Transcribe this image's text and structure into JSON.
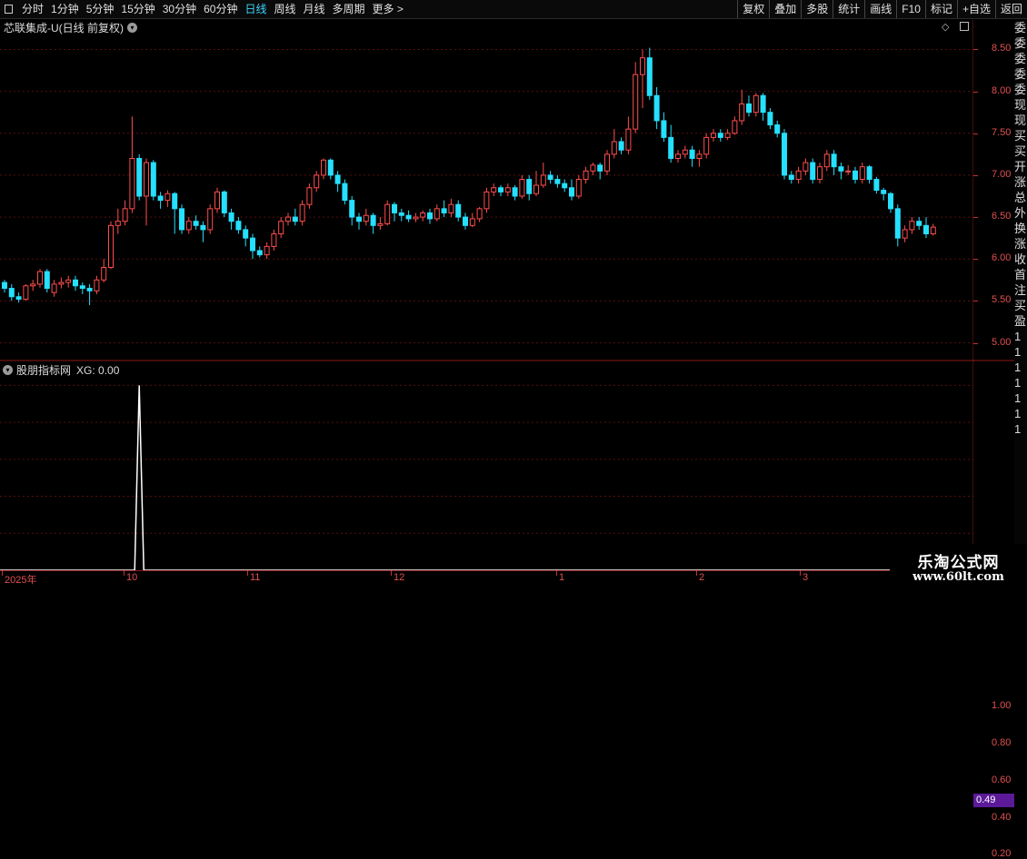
{
  "toolbar": {
    "periods": [
      "分时",
      "1分钟",
      "5分钟",
      "15分钟",
      "30分钟",
      "60分钟",
      "日线",
      "周线",
      "月线",
      "多周期",
      "更多 >"
    ],
    "active_period": "日线",
    "right_buttons": [
      "复权",
      "叠加",
      "多股",
      "统计",
      "画线",
      "F10",
      "标记",
      "+自选",
      "返回"
    ]
  },
  "main_panel": {
    "title": "芯联集成-U(日线 前复权)",
    "price_labels": [
      "8.50",
      "8.00",
      "7.50",
      "7.00",
      "6.50",
      "6.00",
      "5.50",
      "5.00"
    ]
  },
  "indicator_panel": {
    "title": "股朋指标网",
    "value_text": "XG: 0.00",
    "axis_labels": [
      "1.00",
      "0.80",
      "0.60",
      "0.40",
      "0.20"
    ],
    "current_value": "0.49"
  },
  "date_axis": {
    "labels": [
      "2025年",
      "10",
      "11",
      "12",
      "1",
      "2",
      "3"
    ]
  },
  "sidebar_text": [
    "委",
    "委",
    "委",
    "委",
    "委",
    "现",
    "现",
    "买",
    "买",
    "开",
    "涨",
    "总",
    "外",
    "换",
    "涨",
    "收",
    "首",
    "注",
    "买",
    "盈",
    "1",
    "1",
    "1",
    "1",
    "1",
    "1",
    "1"
  ],
  "watermark": {
    "title": "乐淘公式网",
    "url": "www.60lt.com"
  },
  "colors": {
    "up": "#ff4d4d",
    "down": "#25e0ff",
    "grid": "#5a0d0d",
    "axis_line": "#8b1a1a",
    "highlight": "#5c1a99"
  },
  "chart_data": [
    {
      "type": "candlestick",
      "series_name": "芯联集成-U",
      "ylim": [
        4.8,
        8.7
      ],
      "yticks": [
        5.0,
        5.5,
        6.0,
        6.5,
        7.0,
        7.5,
        8.0,
        8.5
      ],
      "candles": [
        [
          5.72,
          5.65,
          5.75,
          5.6
        ],
        [
          5.65,
          5.55,
          5.7,
          5.5
        ],
        [
          5.55,
          5.52,
          5.6,
          5.48
        ],
        [
          5.52,
          5.68,
          5.7,
          5.5
        ],
        [
          5.68,
          5.7,
          5.75,
          5.62
        ],
        [
          5.7,
          5.85,
          5.88,
          5.66
        ],
        [
          5.85,
          5.65,
          5.88,
          5.6
        ],
        [
          5.6,
          5.7,
          5.75,
          5.55
        ],
        [
          5.7,
          5.72,
          5.78,
          5.65
        ],
        [
          5.72,
          5.75,
          5.8,
          5.66
        ],
        [
          5.75,
          5.68,
          5.8,
          5.62
        ],
        [
          5.68,
          5.65,
          5.72,
          5.58
        ],
        [
          5.65,
          5.62,
          5.7,
          5.45
        ],
        [
          5.62,
          5.75,
          5.8,
          5.58
        ],
        [
          5.75,
          5.9,
          6.0,
          5.72
        ],
        [
          5.9,
          6.4,
          6.45,
          5.88
        ],
        [
          6.4,
          6.45,
          6.6,
          6.3
        ],
        [
          6.45,
          6.6,
          6.7,
          6.4
        ],
        [
          6.6,
          7.2,
          7.7,
          6.55
        ],
        [
          7.2,
          6.75,
          7.25,
          6.7
        ],
        [
          6.75,
          7.15,
          7.2,
          6.4
        ],
        [
          7.15,
          6.75,
          7.18,
          6.7
        ],
        [
          6.75,
          6.7,
          6.8,
          6.6
        ],
        [
          6.7,
          6.78,
          6.82,
          6.62
        ],
        [
          6.78,
          6.6,
          6.8,
          6.3
        ],
        [
          6.6,
          6.35,
          6.65,
          6.3
        ],
        [
          6.35,
          6.45,
          6.5,
          6.3
        ],
        [
          6.45,
          6.4,
          6.52,
          6.35
        ],
        [
          6.4,
          6.35,
          6.45,
          6.2
        ],
        [
          6.35,
          6.6,
          6.65,
          6.3
        ],
        [
          6.6,
          6.8,
          6.85,
          6.55
        ],
        [
          6.8,
          6.55,
          6.82,
          6.5
        ],
        [
          6.55,
          6.45,
          6.6,
          6.35
        ],
        [
          6.45,
          6.35,
          6.5,
          6.3
        ],
        [
          6.35,
          6.25,
          6.4,
          6.15
        ],
        [
          6.25,
          6.1,
          6.3,
          6.0
        ],
        [
          6.1,
          6.05,
          6.15,
          6.02
        ],
        [
          6.05,
          6.15,
          6.2,
          6.0
        ],
        [
          6.15,
          6.3,
          6.35,
          6.1
        ],
        [
          6.3,
          6.45,
          6.5,
          6.25
        ],
        [
          6.45,
          6.5,
          6.55,
          6.4
        ],
        [
          6.5,
          6.45,
          6.6,
          6.4
        ],
        [
          6.45,
          6.65,
          6.7,
          6.4
        ],
        [
          6.65,
          6.85,
          6.9,
          6.6
        ],
        [
          6.85,
          7.0,
          7.05,
          6.8
        ],
        [
          7.0,
          7.18,
          7.2,
          6.95
        ],
        [
          7.18,
          7.0,
          7.2,
          6.95
        ],
        [
          7.0,
          6.9,
          7.05,
          6.8
        ],
        [
          6.9,
          6.7,
          6.95,
          6.65
        ],
        [
          6.7,
          6.5,
          6.75,
          6.4
        ],
        [
          6.5,
          6.45,
          6.55,
          6.35
        ],
        [
          6.45,
          6.52,
          6.6,
          6.4
        ],
        [
          6.52,
          6.4,
          6.55,
          6.3
        ],
        [
          6.4,
          6.42,
          6.5,
          6.35
        ],
        [
          6.42,
          6.65,
          6.7,
          6.4
        ],
        [
          6.65,
          6.55,
          6.68,
          6.45
        ],
        [
          6.55,
          6.52,
          6.6,
          6.45
        ],
        [
          6.52,
          6.48,
          6.58,
          6.44
        ],
        [
          6.48,
          6.5,
          6.55,
          6.44
        ],
        [
          6.5,
          6.55,
          6.58,
          6.45
        ],
        [
          6.55,
          6.48,
          6.6,
          6.42
        ],
        [
          6.48,
          6.6,
          6.65,
          6.45
        ],
        [
          6.6,
          6.55,
          6.7,
          6.5
        ],
        [
          6.55,
          6.65,
          6.72,
          6.5
        ],
        [
          6.65,
          6.5,
          6.7,
          6.45
        ],
        [
          6.5,
          6.4,
          6.55,
          6.35
        ],
        [
          6.4,
          6.48,
          6.55,
          6.38
        ],
        [
          6.48,
          6.6,
          6.62,
          6.44
        ],
        [
          6.6,
          6.8,
          6.85,
          6.55
        ],
        [
          6.8,
          6.85,
          6.9,
          6.75
        ],
        [
          6.85,
          6.8,
          6.88,
          6.75
        ],
        [
          6.8,
          6.85,
          6.9,
          6.75
        ],
        [
          6.85,
          6.75,
          6.88,
          6.7
        ],
        [
          6.75,
          6.95,
          7.0,
          6.72
        ],
        [
          6.95,
          6.78,
          7.0,
          6.7
        ],
        [
          6.78,
          6.88,
          7.05,
          6.75
        ],
        [
          6.88,
          7.0,
          7.15,
          6.85
        ],
        [
          7.0,
          6.95,
          7.05,
          6.9
        ],
        [
          6.95,
          6.9,
          7.0,
          6.85
        ],
        [
          6.9,
          6.85,
          6.95,
          6.8
        ],
        [
          6.85,
          6.75,
          6.95,
          6.7
        ],
        [
          6.75,
          6.95,
          7.0,
          6.72
        ],
        [
          6.95,
          7.05,
          7.1,
          6.9
        ],
        [
          7.05,
          7.12,
          7.15,
          7.0
        ],
        [
          7.12,
          7.05,
          7.15,
          6.95
        ],
        [
          7.05,
          7.25,
          7.3,
          7.0
        ],
        [
          7.25,
          7.4,
          7.55,
          7.2
        ],
        [
          7.4,
          7.3,
          7.45,
          7.25
        ],
        [
          7.3,
          7.55,
          7.7,
          7.25
        ],
        [
          7.55,
          8.2,
          8.35,
          7.5
        ],
        [
          8.2,
          8.4,
          8.5,
          7.8
        ],
        [
          8.4,
          7.95,
          8.52,
          7.9
        ],
        [
          7.95,
          7.65,
          8.05,
          7.55
        ],
        [
          7.65,
          7.45,
          7.75,
          7.4
        ],
        [
          7.45,
          7.2,
          7.6,
          7.15
        ],
        [
          7.2,
          7.25,
          7.3,
          7.15
        ],
        [
          7.25,
          7.3,
          7.35,
          7.2
        ],
        [
          7.3,
          7.2,
          7.35,
          7.1
        ],
        [
          7.2,
          7.25,
          7.3,
          7.1
        ],
        [
          7.25,
          7.45,
          7.5,
          7.2
        ],
        [
          7.45,
          7.5,
          7.55,
          7.4
        ],
        [
          7.5,
          7.45,
          7.55,
          7.4
        ],
        [
          7.45,
          7.5,
          7.55,
          7.42
        ],
        [
          7.5,
          7.65,
          7.7,
          7.48
        ],
        [
          7.65,
          7.85,
          8.02,
          7.6
        ],
        [
          7.85,
          7.75,
          7.95,
          7.7
        ],
        [
          7.75,
          7.95,
          7.98,
          7.7
        ],
        [
          7.95,
          7.75,
          7.98,
          7.65
        ],
        [
          7.75,
          7.6,
          7.8,
          7.55
        ],
        [
          7.6,
          7.5,
          7.65,
          7.45
        ],
        [
          7.5,
          7.0,
          7.55,
          6.95
        ],
        [
          7.0,
          6.95,
          7.05,
          6.9
        ],
        [
          6.95,
          7.05,
          7.1,
          6.9
        ],
        [
          7.05,
          7.15,
          7.2,
          7.0
        ],
        [
          7.15,
          6.95,
          7.2,
          6.9
        ],
        [
          6.95,
          7.1,
          7.15,
          6.9
        ],
        [
          7.1,
          7.25,
          7.3,
          7.05
        ],
        [
          7.25,
          7.1,
          7.3,
          7.0
        ],
        [
          7.1,
          7.05,
          7.15,
          6.95
        ],
        [
          7.05,
          7.05,
          7.12,
          7.0
        ],
        [
          7.05,
          6.95,
          7.1,
          6.9
        ],
        [
          6.95,
          7.1,
          7.15,
          6.9
        ],
        [
          7.1,
          6.95,
          7.12,
          6.9
        ],
        [
          6.95,
          6.82,
          6.98,
          6.78
        ],
        [
          6.82,
          6.78,
          6.85,
          6.7
        ],
        [
          6.78,
          6.6,
          6.8,
          6.55
        ],
        [
          6.6,
          6.25,
          6.65,
          6.15
        ],
        [
          6.25,
          6.35,
          6.4,
          6.2
        ],
        [
          6.35,
          6.45,
          6.5,
          6.3
        ],
        [
          6.45,
          6.4,
          6.5,
          6.35
        ],
        [
          6.4,
          6.3,
          6.5,
          6.25
        ],
        [
          6.3,
          6.38,
          6.42,
          6.28
        ]
      ]
    },
    {
      "type": "line",
      "series_name": "XG",
      "ylim": [
        0,
        1.1
      ],
      "yticks": [
        0.2,
        0.4,
        0.6,
        0.8,
        1.0
      ],
      "spike_index": 19,
      "spike_value": 1.0
    }
  ]
}
